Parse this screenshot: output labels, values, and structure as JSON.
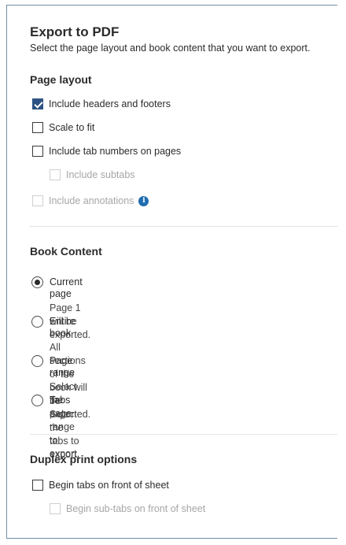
{
  "dialog": {
    "title": "Export to PDF",
    "subtitle": "Select the page layout and book content that you want to export."
  },
  "page_layout": {
    "heading": "Page layout",
    "options": [
      {
        "label": "Include headers and footers",
        "checked": true,
        "disabled": false
      },
      {
        "label": "Scale to fit",
        "checked": false,
        "disabled": false
      },
      {
        "label": "Include tab numbers on pages",
        "checked": false,
        "disabled": false
      },
      {
        "label": "Include subtabs",
        "checked": false,
        "disabled": true
      },
      {
        "label": "Include annotations",
        "checked": false,
        "disabled": true,
        "info_icon": "info-icon"
      }
    ]
  },
  "book_content": {
    "heading": "Book Content",
    "selected": "Current page",
    "options": [
      {
        "label": "Current page",
        "description": "Page 1 will be exported."
      },
      {
        "label": "Entire book",
        "description": "All sections of the book will be exported."
      },
      {
        "label": "Page range",
        "description": "Select the page range to export."
      },
      {
        "label": "Tabs",
        "description": "Select the tabs to export."
      }
    ]
  },
  "duplex": {
    "heading": "Duplex print options",
    "options": [
      {
        "label": "Begin tabs on front of sheet",
        "checked": false,
        "disabled": false
      },
      {
        "label": "Begin sub-tabs on front of sheet",
        "checked": false,
        "disabled": true
      }
    ]
  },
  "colors": {
    "accent": "#2c5282",
    "info": "#1f6db0",
    "border": "#6f8fa8",
    "disabled_text": "#a6a6a6"
  }
}
